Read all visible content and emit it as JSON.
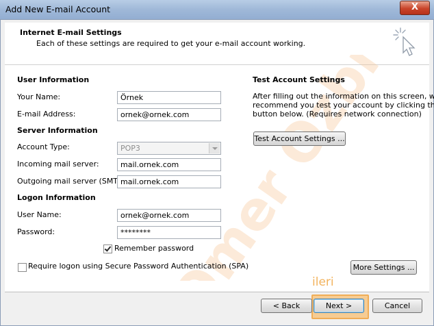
{
  "window": {
    "title": "Add New E-mail Account",
    "close_glyph": "X"
  },
  "header": {
    "title": "Internet E-mail Settings",
    "subtitle": "Each of these settings are required to get your e-mail account working."
  },
  "user_info": {
    "heading": "User Information",
    "name_label": "Your Name:",
    "name_value": "Örnek",
    "email_label": "E-mail Address:",
    "email_value": "ornek@ornek.com"
  },
  "server_info": {
    "heading": "Server Information",
    "type_label": "Account Type:",
    "type_value": "POP3",
    "incoming_label": "Incoming mail server:",
    "incoming_value": "mail.ornek.com",
    "outgoing_label": "Outgoing mail server (SMTP):",
    "outgoing_value": "mail.ornek.com"
  },
  "logon_info": {
    "heading": "Logon Information",
    "user_label": "User Name:",
    "user_value": "ornek@ornek.com",
    "password_label": "Password:",
    "password_value": "********",
    "remember_label": "Remember password",
    "remember_checked": true,
    "spa_label": "Require logon using Secure Password Authentication (SPA)",
    "spa_checked": false
  },
  "test": {
    "heading": "Test Account Settings",
    "desc_1": "After filling out the information on this screen, we",
    "desc_2": "recommend you test your account by clicking the",
    "desc_3": "button below. (Requires network connection)",
    "button": "Test Account Settings ..."
  },
  "more_settings": "More Settings ...",
  "nav": {
    "back": "< Back",
    "next": "Next >",
    "cancel": "Cancel"
  },
  "annotation": {
    "text": "ileri",
    "color": "#f2b35e"
  },
  "watermark": {
    "text": "Omer Ozbi",
    "color": "#f6c99b"
  }
}
